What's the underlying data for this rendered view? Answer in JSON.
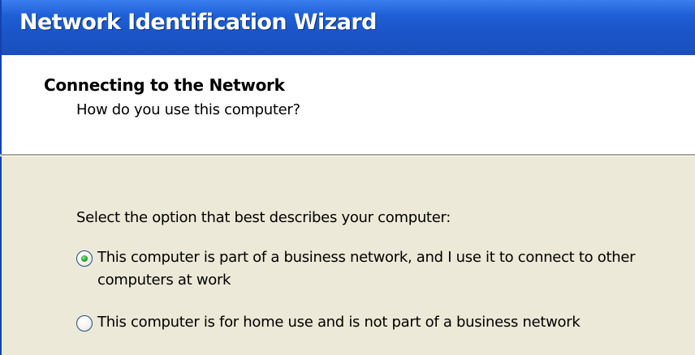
{
  "window": {
    "title": "Network Identification Wizard"
  },
  "header": {
    "title": "Connecting to the Network",
    "subtitle": "How do you use this computer?"
  },
  "body": {
    "instruction": "Select the option that best describes your computer:",
    "options": [
      {
        "label": "This computer is part of a business network, and I use it to connect to other computers at work",
        "selected": true
      },
      {
        "label": "This computer is for home use and is not part of a business network",
        "selected": false
      }
    ]
  },
  "colors": {
    "titlebar": "#1f5cd1",
    "body_background": "#ece9d8",
    "radio_selected": "#21a121"
  },
  "icons": {
    "radio_selected": "radio-selected-icon",
    "radio_unselected": "radio-unselected-icon"
  }
}
